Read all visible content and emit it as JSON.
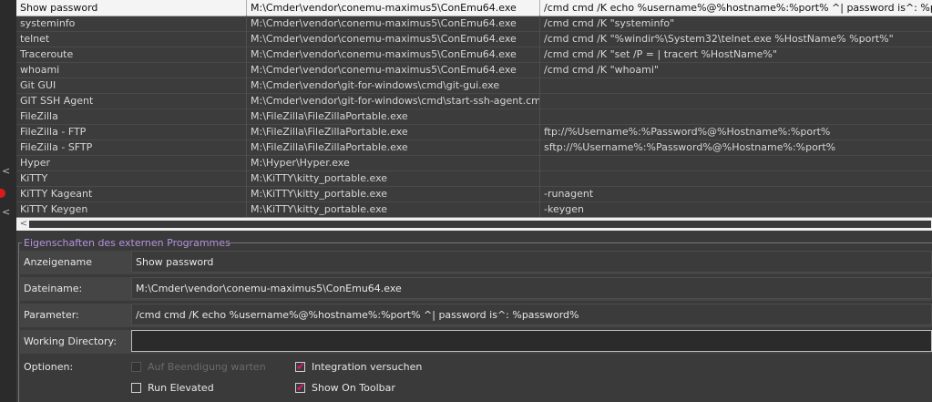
{
  "programs": [
    {
      "name": "Show password",
      "path": "M:\\Cmder\\vendor\\conemu-maximus5\\ConEmu64.exe",
      "params": "/cmd cmd /K echo %username%@%hostname%:%port% ^| password is^: %password%"
    },
    {
      "name": "systeminfo",
      "path": "M:\\Cmder\\vendor\\conemu-maximus5\\ConEmu64.exe",
      "params": "/cmd cmd /K \"systeminfo\""
    },
    {
      "name": "telnet",
      "path": "M:\\Cmder\\vendor\\conemu-maximus5\\ConEmu64.exe",
      "params": "/cmd cmd /K \"%windir%\\System32\\telnet.exe %HostName% %port%\""
    },
    {
      "name": "Traceroute",
      "path": "M:\\Cmder\\vendor\\conemu-maximus5\\ConEmu64.exe",
      "params": "/cmd cmd /K \"set /P = | tracert %HostName%\""
    },
    {
      "name": "whoami",
      "path": "M:\\Cmder\\vendor\\conemu-maximus5\\ConEmu64.exe",
      "params": "/cmd cmd /K \"whoami\""
    },
    {
      "name": "Git GUI",
      "path": "M:\\Cmder\\vendor\\git-for-windows\\cmd\\git-gui.exe",
      "params": ""
    },
    {
      "name": "GIT SSH Agent",
      "path": "M:\\Cmder\\vendor\\git-for-windows\\cmd\\start-ssh-agent.cmd",
      "params": ""
    },
    {
      "name": "FileZilla",
      "path": "M:\\FileZilla\\FileZillaPortable.exe",
      "params": ""
    },
    {
      "name": "FileZilla - FTP",
      "path": "M:\\FileZilla\\FileZillaPortable.exe",
      "params": "ftp://%Username%:%Password%@%Hostname%:%port%"
    },
    {
      "name": "FileZilla - SFTP",
      "path": "M:\\FileZilla\\FileZillaPortable.exe",
      "params": "sftp://%Username%:%Password%@%Hostname%:%port%"
    },
    {
      "name": "Hyper",
      "path": "M:\\Hyper\\Hyper.exe",
      "params": ""
    },
    {
      "name": "KiTTY",
      "path": "M:\\KiTTY\\kitty_portable.exe",
      "params": ""
    },
    {
      "name": "KiTTY Kageant",
      "path": "M:\\KiTTY\\kitty_portable.exe",
      "params": "-runagent"
    },
    {
      "name": "KiTTY Keygen",
      "path": "M:\\KiTTY\\kitty_portable.exe",
      "params": "-keygen"
    }
  ],
  "scroll": {
    "left_arrow": "<"
  },
  "gutter": {
    "chevron": "<"
  },
  "properties": {
    "title": "Eigenschaften des externen Programmes",
    "display_name_label": "Anzeigename",
    "display_name_value": "Show password",
    "filename_label": "Dateiname:",
    "filename_value": "M:\\Cmder\\vendor\\conemu-maximus5\\ConEmu64.exe",
    "parameter_label": "Parameter:",
    "parameter_value": "/cmd cmd /K echo %username%@%hostname%:%port% ^| password is^: %password%",
    "workdir_label": "Working Directory:",
    "workdir_value": "",
    "options_label": "Optionen:"
  },
  "options": {
    "wait_label": "Auf Beendigung warten",
    "wait_checked": false,
    "wait_disabled": true,
    "integration_label": "Integration versuchen",
    "integration_checked": true,
    "elevated_label": "Run Elevated",
    "elevated_checked": false,
    "toolbar_label": "Show On Toolbar",
    "toolbar_checked": true,
    "check_glyph": "✔"
  },
  "colors": {
    "accent_legend": "#b493e0",
    "check_tick": "#e3197b",
    "selected_row": "#f4f4f4"
  }
}
